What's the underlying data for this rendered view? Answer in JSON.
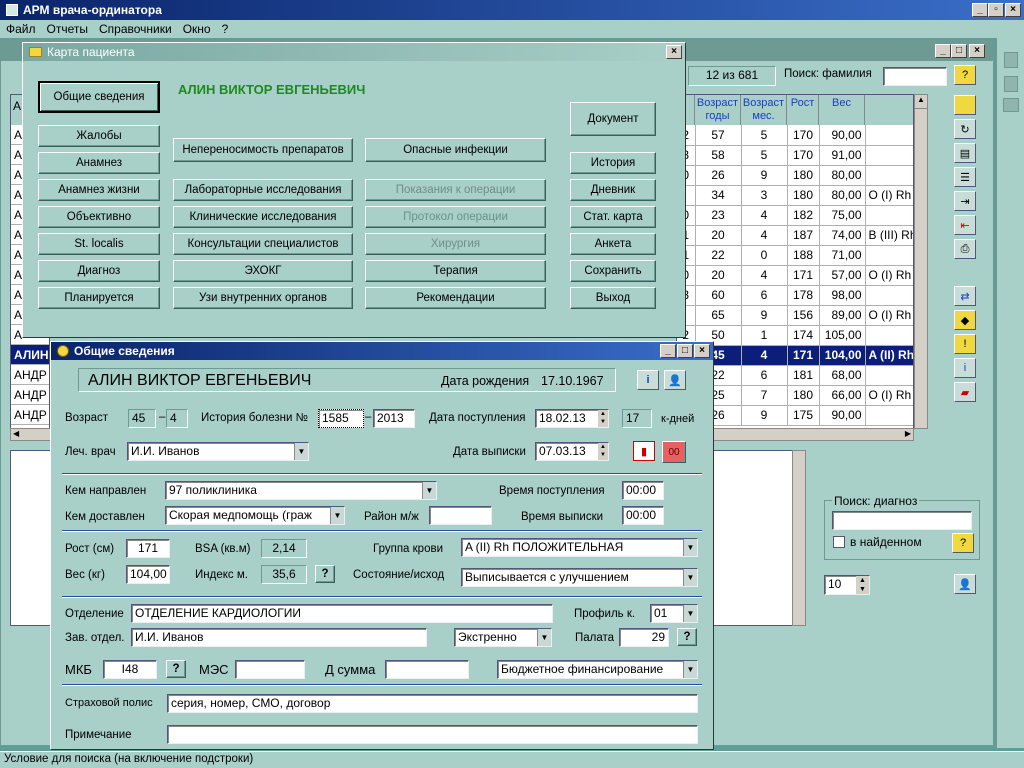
{
  "app": {
    "title": "АРМ врача-ординатора",
    "menu": [
      "Файл",
      "Отчеты",
      "Справочники",
      "Окно",
      "?"
    ],
    "status_bar": "Условие для поиска (на включение подстроки)"
  },
  "bg_window": {
    "counter": "12 из 681",
    "search_label": "Поиск: фамилия",
    "search_value": "",
    "col_headers": [
      "Возраст годы",
      "Возраст мес.",
      "Рост",
      "Вес",
      ""
    ],
    "rows": [
      [
        "2",
        "57",
        "5",
        "170",
        "90,00",
        ""
      ],
      [
        "3",
        "58",
        "5",
        "170",
        "91,00",
        ""
      ],
      [
        "0",
        "26",
        "9",
        "180",
        "80,00",
        ""
      ],
      [
        "",
        "34",
        "3",
        "180",
        "80,00",
        "O (I) Rh"
      ],
      [
        "0",
        "23",
        "4",
        "182",
        "75,00",
        ""
      ],
      [
        "1",
        "20",
        "4",
        "187",
        "74,00",
        "B (III) Rh"
      ],
      [
        "1",
        "22",
        "0",
        "188",
        "71,00",
        ""
      ],
      [
        "0",
        "20",
        "4",
        "171",
        "57,00",
        "O (I) Rh"
      ],
      [
        "3",
        "60",
        "6",
        "178",
        "98,00",
        ""
      ],
      [
        "",
        "65",
        "9",
        "156",
        "89,00",
        "O (I) Rh"
      ],
      [
        "2",
        "50",
        "1",
        "174",
        "105,00",
        ""
      ],
      [
        "5",
        "45",
        "4",
        "171",
        "104,00",
        "A (II) Rh"
      ],
      [
        "",
        "22",
        "6",
        "181",
        "68,00",
        ""
      ],
      [
        "5",
        "25",
        "7",
        "180",
        "66,00",
        "O (I) Rh"
      ],
      [
        "6",
        "26",
        "9",
        "175",
        "90,00",
        ""
      ]
    ],
    "selected_row": 11,
    "left_names": [
      "А",
      "А",
      "А",
      "А",
      "А",
      "А",
      "А",
      "А",
      "А",
      "А",
      "А",
      "АЛИН",
      "АНДР",
      "АНДР",
      "АНДР"
    ],
    "left_header": "А",
    "diag_search_label": "Поиск: диагноз",
    "diag_search_value": "",
    "in_found_label": "в найденном",
    "page_size": "10"
  },
  "card_window": {
    "title": "Карта пациента",
    "patient_name": "АЛИН ВИКТОР ЕВГЕНЬЕВИЧ",
    "buttons_col1": [
      "Общие сведения",
      "Жалобы",
      "Анамнез",
      "Анамнез жизни",
      "Объективно",
      "St. localis",
      "Диагноз",
      "Планируется"
    ],
    "buttons_col2": [
      "Непереносимость препаратов",
      "Лабораторные исследования",
      "Клинические исследования",
      "Консультации специалистов",
      "ЭХОКГ",
      "Узи внутренних органов"
    ],
    "buttons_col3": [
      "Опасные инфекции",
      "Показания к операции",
      "Протокол операции",
      "Хирургия",
      "Терапия",
      "Рекомендации"
    ],
    "buttons_col4": [
      "Документ",
      "История",
      "Дневник",
      "Стат. карта",
      "Анкета",
      "Сохранить",
      "Выход"
    ]
  },
  "info_window": {
    "title": "Общие сведения",
    "patient_name": "АЛИН ВИКТОР ЕВГЕНЬЕВИЧ",
    "dob_label": "Дата рождения",
    "dob": "17.10.1967",
    "age_label": "Возраст",
    "age_years": "45",
    "age_months": "4",
    "history_label": "История болезни №",
    "history_no": "1585",
    "history_year": "2013",
    "admission_label": "Дата поступления",
    "admission_date": "18.02.13",
    "bed_days": "17",
    "bed_days_label": "к-дней",
    "doctor_label": "Леч. врач",
    "doctor": "И.И. Иванов",
    "discharge_label": "Дата выписки",
    "discharge_date": "07.03.13",
    "red_btn": "00",
    "referred_label": "Кем направлен",
    "referred": "97 поликлиника",
    "adm_time_label": "Время поступления",
    "adm_time": "00:00",
    "delivered_label": "Кем доставлен",
    "delivered": "Скорая медпомощь (граж",
    "district_label": "Район м/ж",
    "district": "",
    "dis_time_label": "Время выписки",
    "dis_time": "00:00",
    "height_label": "Рост (см)",
    "height": "171",
    "bsa_label": "BSA (кв.м)",
    "bsa": "2,14",
    "blood_label": "Группа крови",
    "blood": "A (II) Rh ПОЛОЖИТЕЛЬНАЯ",
    "weight_label": "Вес (кг)",
    "weight": "104,00",
    "bmi_label": "Индекс м.",
    "bmi": "35,6",
    "state_label": "Состояние/исход",
    "state": "Выписывается с улучшением",
    "dept_label": "Отделение",
    "dept": "ОТДЕЛЕНИЕ КАРДИОЛОГИИ",
    "profile_label": "Профиль к.",
    "profile": "01",
    "head_label": "Зав. отдел.",
    "head": "И.И. Иванов",
    "urgency": "Экстренно",
    "ward_label": "Палата",
    "ward": "29",
    "mkb_label": "МКБ",
    "mkb": "I48",
    "mes_label": "МЭС",
    "mes": "",
    "dsum_label": "Д сумма",
    "dsum": "",
    "funding": "Бюджетное финансирование",
    "policy_label": "Страховой полис",
    "policy": "серия, номер, СМО, договор",
    "note_label": "Примечание",
    "note": "",
    "q": "?"
  },
  "colors": {
    "title_bar": "#0a246a",
    "window_bg": "#a8cfc8",
    "desktop": "#5f9e98",
    "name_green": "#1e8a1e"
  }
}
